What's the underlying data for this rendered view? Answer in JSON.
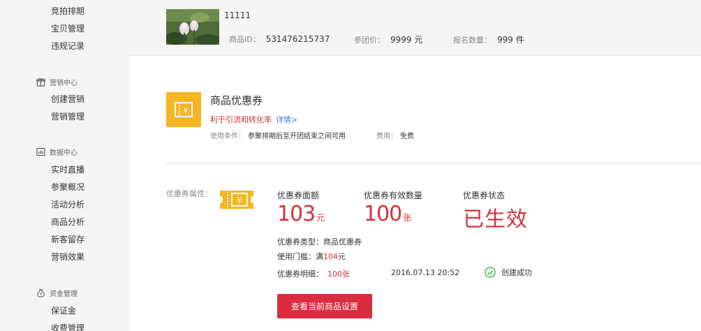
{
  "sidebar": {
    "top_items": [
      {
        "label": "竞拍排期"
      },
      {
        "label": "宝贝管理"
      },
      {
        "label": "违规记录"
      }
    ],
    "sections": [
      {
        "label": "营销中心",
        "icon": "gift-icon",
        "items": [
          {
            "label": "创建营销"
          },
          {
            "label": "营销管理"
          }
        ]
      },
      {
        "label": "数据中心",
        "icon": "data-icon",
        "items": [
          {
            "label": "实时直播"
          },
          {
            "label": "参聚概况"
          },
          {
            "label": "活动分析"
          },
          {
            "label": "商品分析"
          },
          {
            "label": "新客留存"
          },
          {
            "label": "营销效果"
          }
        ]
      },
      {
        "label": "资金管理",
        "icon": "money-icon",
        "items": [
          {
            "label": "保证金"
          },
          {
            "label": "收费管理"
          }
        ]
      }
    ]
  },
  "product": {
    "name": "11111",
    "id_label": "商品ID：",
    "id_value": "531476215737",
    "price_label": "参团价：",
    "price_value": "9999 元",
    "qty_label": "报名数量：",
    "qty_value": "999 件"
  },
  "feature": {
    "title": "商品优惠券",
    "subtitle": "利于引流和转化率",
    "detail_link": "详情>",
    "condition_label": "使用条件：",
    "condition_value": "参聚排期后至开团结束之间可用",
    "fee_label": "费用：",
    "fee_value": "免费"
  },
  "coupon": {
    "attr_label": "优惠券属性：",
    "face_title": "优惠券面额",
    "face_value": "103",
    "face_unit": "元",
    "count_title": "优惠券有效数量",
    "count_value": "100",
    "count_unit": "张",
    "status_title": "优惠券状态",
    "status_value": "已生效",
    "type_label": "优惠券类型：",
    "type_value": "商品优惠券",
    "threshold_label": "使用门槛：",
    "threshold_prefix": "满",
    "threshold_value": "104",
    "threshold_unit": "元",
    "detail_label": "优惠券明细：",
    "detail_value": "100张",
    "timestamp": "2016.07.13 20:52",
    "result": "创建成功",
    "button": "查看当前商品设置"
  },
  "colors": {
    "accent_red": "#d4323c",
    "button_red": "#d92c3f",
    "icon_orange": "#f5b623",
    "success_green": "#3bb34a",
    "link_blue": "#3a7cc8"
  }
}
